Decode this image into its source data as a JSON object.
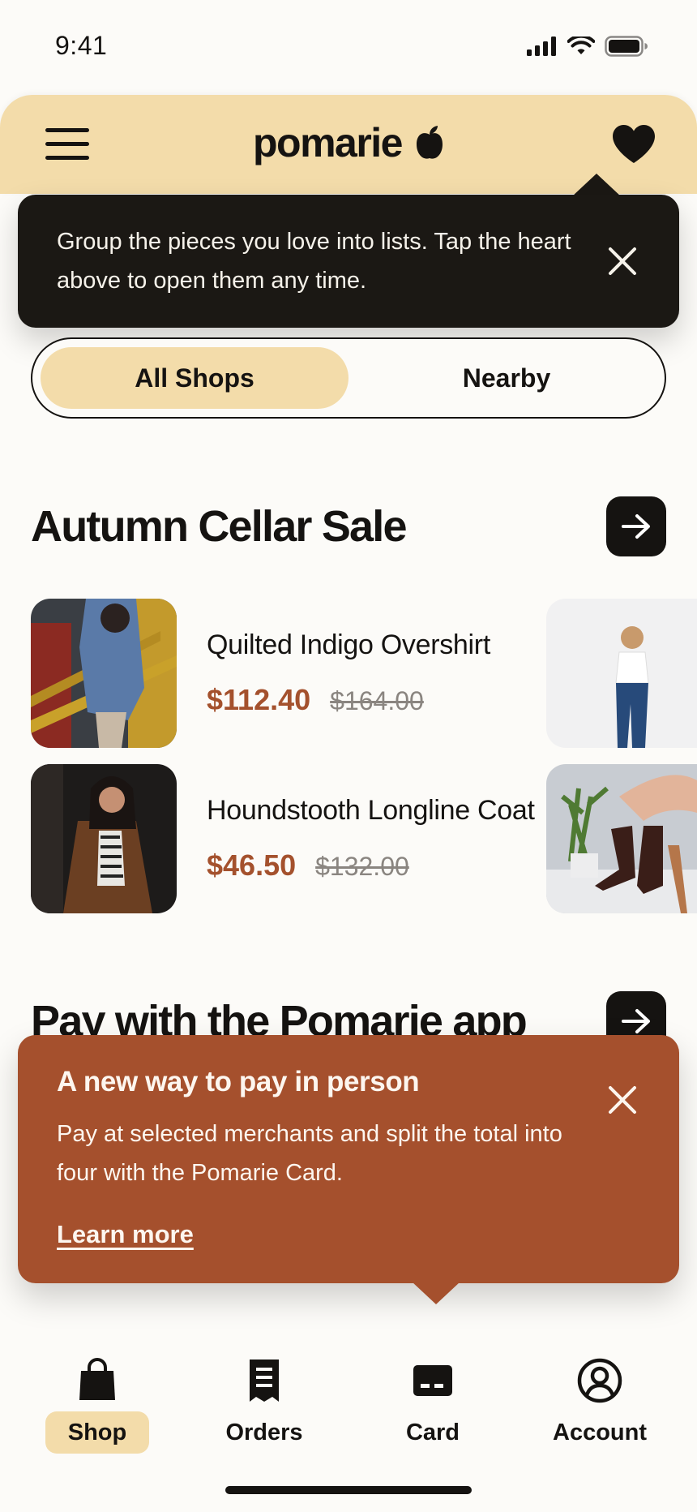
{
  "status_bar": {
    "time": "9:41"
  },
  "header": {
    "brand": "pomarie"
  },
  "wishlist_tooltip": {
    "text": "Group the pieces you love into lists. Tap the heart above to open them any time."
  },
  "segmented": {
    "options": [
      "All Shops",
      "Nearby"
    ],
    "selected": "All Shops"
  },
  "sale_section": {
    "title": "Autumn Cellar Sale",
    "products": [
      {
        "name": "Quilted Indigo Overshirt",
        "price": "$112.40",
        "old_price": "$164.00"
      },
      {
        "name": "Houndstooth Longline Coat",
        "price": "$46.50",
        "old_price": "$132.00"
      }
    ]
  },
  "pay_section": {
    "title": "Pay with the Pomarie app"
  },
  "promo_tooltip": {
    "title": "A new way to pay in person",
    "body": "Pay at selected merchants and split the total into four with the Pomarie Card.",
    "link": "Learn more"
  },
  "tabbar": {
    "tabs": [
      {
        "label": "Shop",
        "icon": "shopping-bag-icon",
        "active": true
      },
      {
        "label": "Orders",
        "icon": "receipt-icon",
        "active": false
      },
      {
        "label": "Card",
        "icon": "card-icon",
        "active": false
      },
      {
        "label": "Account",
        "icon": "account-icon",
        "active": false
      }
    ]
  },
  "colors": {
    "accent": "#f3dcaa",
    "promo": "#a5502d",
    "sale_price": "#a4512d",
    "dark": "#1b1814"
  }
}
